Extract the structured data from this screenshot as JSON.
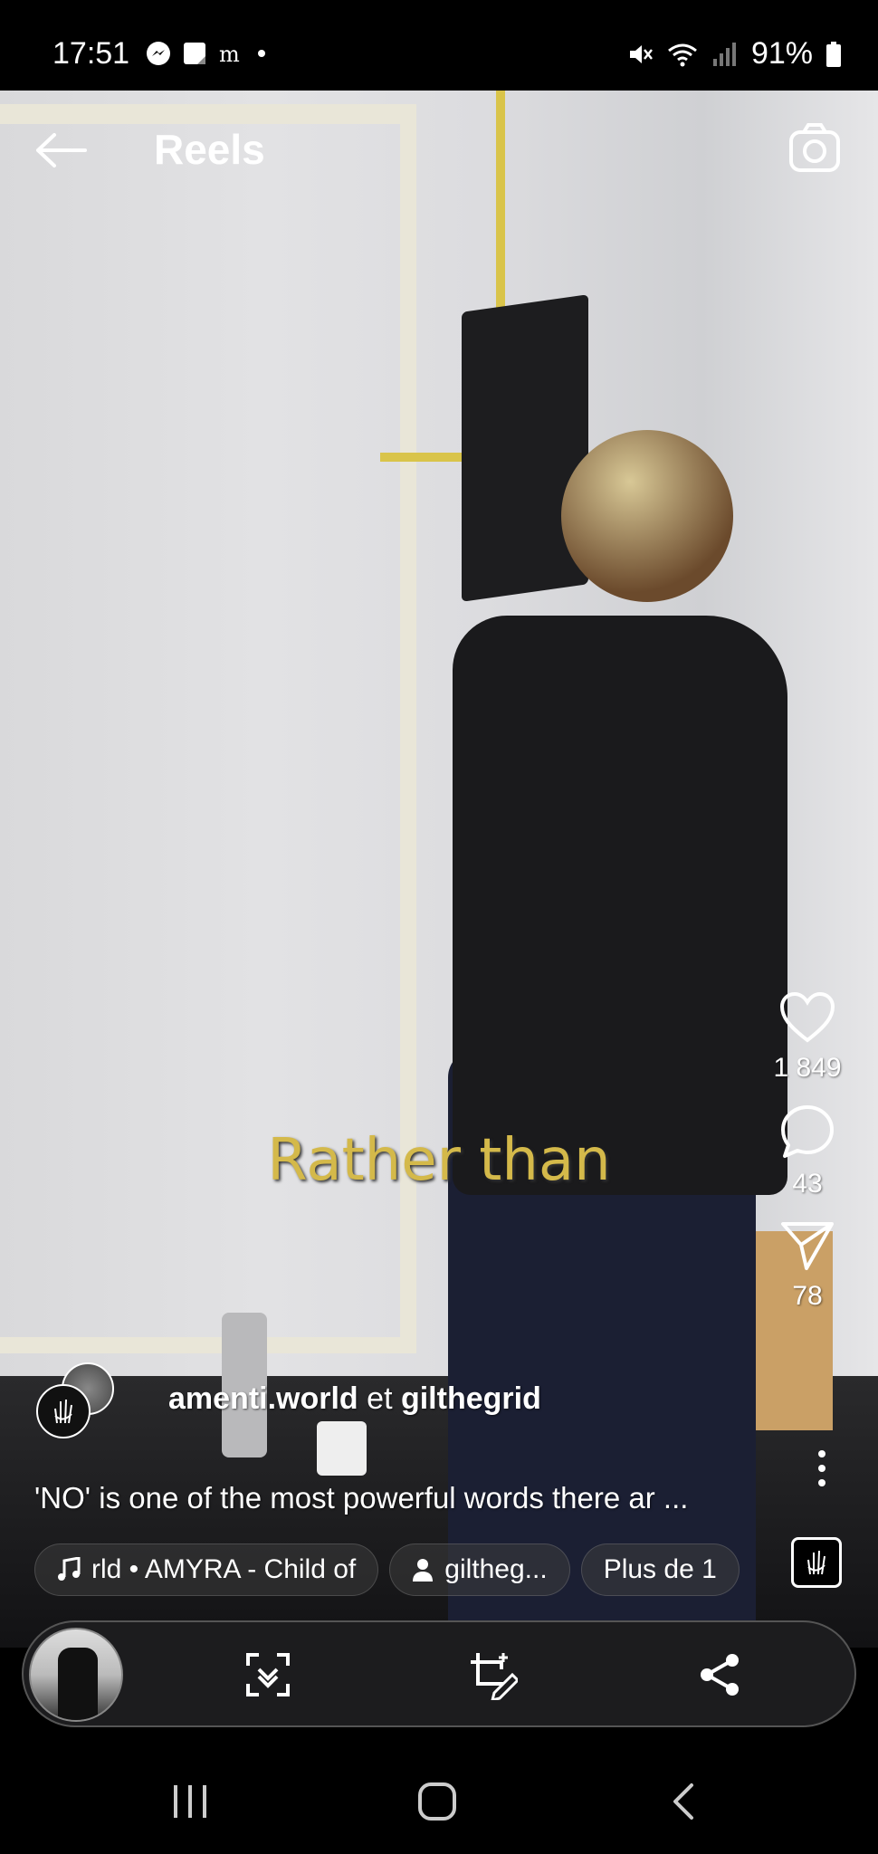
{
  "status_bar": {
    "time": "17:51",
    "battery": "91%"
  },
  "header": {
    "title": "Reels"
  },
  "video": {
    "caption_overlay": "Rather than"
  },
  "actions": {
    "likes": "1 849",
    "comments": "43",
    "shares": "78"
  },
  "author": {
    "primary": "amenti.world",
    "connector": "et",
    "secondary": "gilthegrid"
  },
  "description": "'NO' is one of the most powerful words there ar ...",
  "chips": {
    "audio": "rld • AMYRA - Child of",
    "tagged": "giltheg...",
    "more": "Plus de 1"
  },
  "icons": [
    "back-arrow-icon",
    "camera-icon",
    "heart-icon",
    "comment-icon",
    "send-icon",
    "more-vertical-icon",
    "music-note-icon",
    "person-icon",
    "scan-icon",
    "edit-crop-icon",
    "share-icon",
    "recents-icon",
    "home-icon",
    "nav-back-icon"
  ]
}
